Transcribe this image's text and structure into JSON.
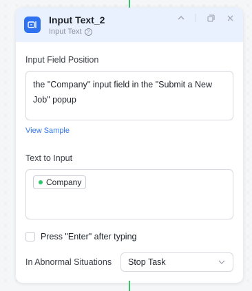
{
  "node": {
    "title": "Input Text_2",
    "subtitle": "Input Text",
    "accent": "#2f72f0",
    "icon": "input-text-icon"
  },
  "header_actions": [
    "chevron-up-icon",
    "copy-icon",
    "close-icon"
  ],
  "fields": {
    "position_label": "Input Field Position",
    "position_value": "the \"Company\" input field in the \"Submit a New Job\" popup",
    "view_sample": "View Sample",
    "text_label": "Text to Input",
    "text_tag": "Company",
    "tag_dot_color": "#2ec66a",
    "press_enter_label": "Press \"Enter\" after typing",
    "press_enter_checked": false,
    "abnormal_label": "In Abnormal Situations",
    "abnormal_value": "Stop Task"
  },
  "connector_color": "#35c46a"
}
